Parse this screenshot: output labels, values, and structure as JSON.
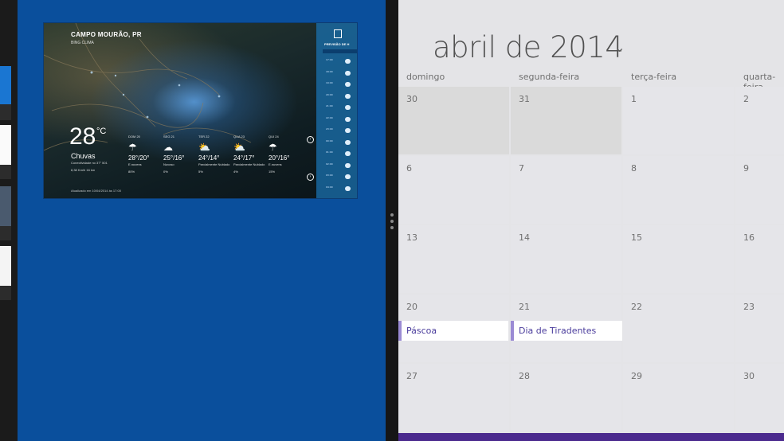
{
  "weather": {
    "city": "CAMPO MOURÃO, PR",
    "source": "BING CLIMA",
    "temperature": "28",
    "unit": "°C",
    "condition": "Chuvas",
    "detail1": "Conectividade no 37° 501",
    "detail2": "8,38 Km/h    16 km",
    "footer": "Atualizado em 10/04/2014 às 17:00",
    "forecast": [
      {
        "day": "DOM 20",
        "icon": "rain-icon",
        "temps": "28°/20°",
        "desc": "E.nuvens",
        "precip": "80%"
      },
      {
        "day": "SEG 21",
        "icon": "storm-icon",
        "temps": "25°/16°",
        "desc": "Nuvoso",
        "precip": "0%"
      },
      {
        "day": "TER 22",
        "icon": "partly-sunny-icon",
        "temps": "24°/14°",
        "desc": "Parcialmente Nublado",
        "precip": "5%"
      },
      {
        "day": "QUA 23",
        "icon": "partly-sunny-icon",
        "temps": "24°/17°",
        "desc": "Parcialmente Nublado",
        "precip": "4%"
      },
      {
        "day": "QUI 24",
        "icon": "rain-icon",
        "temps": "20°/16°",
        "desc": "E.nuvens",
        "precip": "15%"
      }
    ],
    "panel_title": "PREVISÃO DE H",
    "hourly": [
      "17:00",
      "18:00",
      "19:00",
      "20:00",
      "21:00",
      "22:00",
      "23:00",
      "00:00",
      "01:00",
      "02:00",
      "03:00",
      "04:00"
    ]
  },
  "calendar": {
    "month_title": "abril de 2014",
    "chevron": "⌄",
    "day_headers": [
      "domingo",
      "segunda-feira",
      "terça-feira",
      "quarta-feira"
    ],
    "weeks": [
      [
        "30",
        "31",
        "1",
        "2"
      ],
      [
        "6",
        "7",
        "8",
        "9"
      ],
      [
        "13",
        "14",
        "15",
        "16"
      ],
      [
        "20",
        "21",
        "22",
        "23"
      ],
      [
        "27",
        "28",
        "29",
        "30"
      ]
    ],
    "events": [
      {
        "label": "Páscoa"
      },
      {
        "label": "Dia de Tiradentes"
      }
    ]
  },
  "colors": {
    "snap_background": "#0a4f9c",
    "calendar_background": "#e4e4e7",
    "event_accent": "#9b8bd4",
    "bottom_bar": "#4b2a8e"
  }
}
